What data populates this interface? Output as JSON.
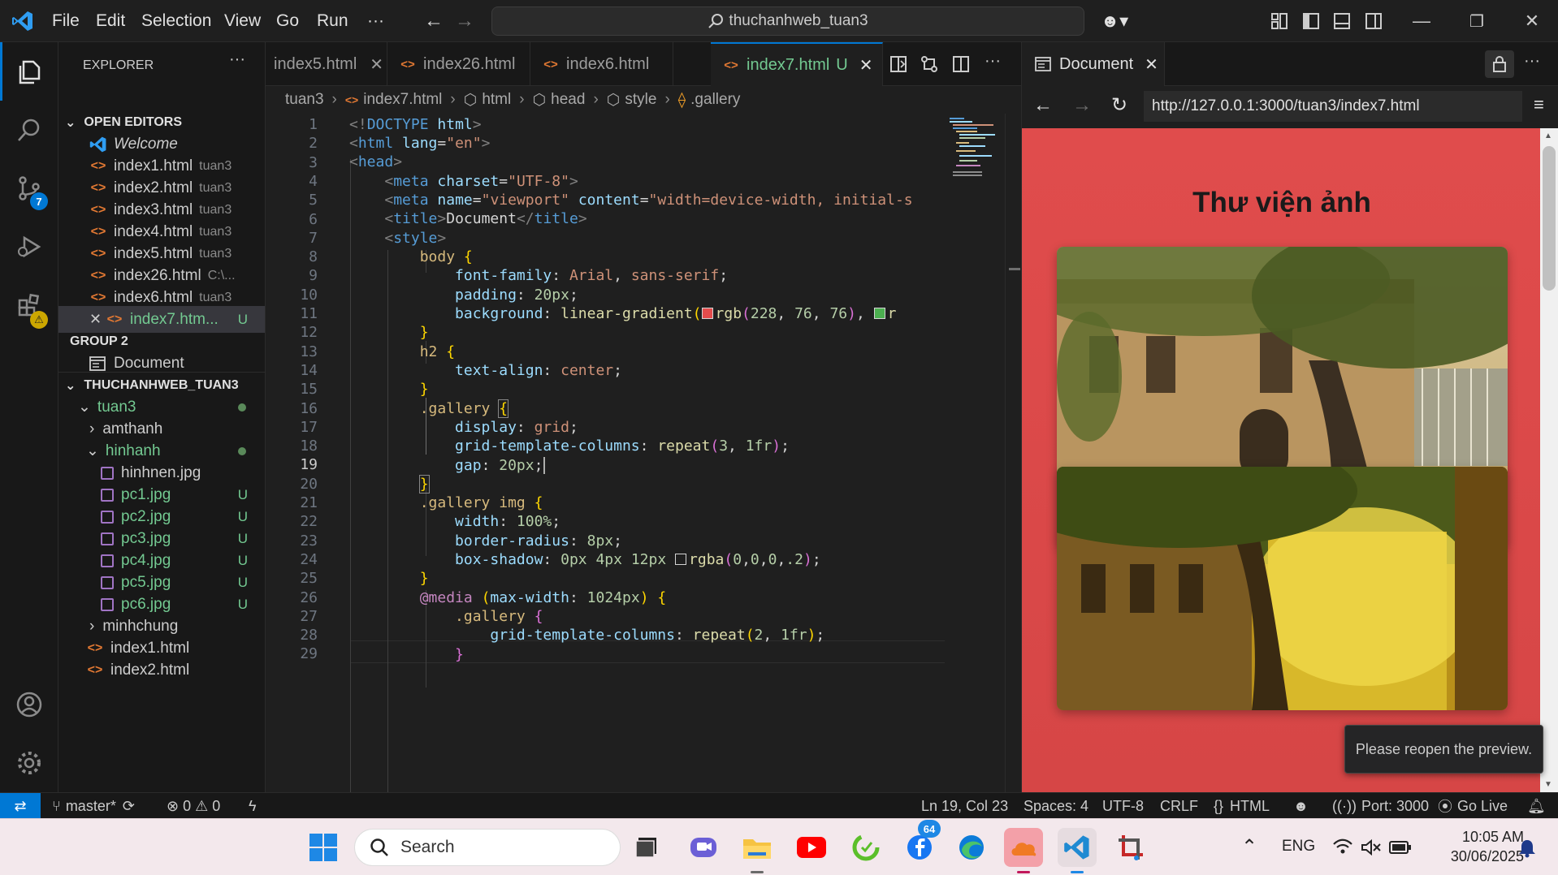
{
  "menu": [
    "File",
    "Edit",
    "Selection",
    "View",
    "Go",
    "Run",
    "···"
  ],
  "command_center": "thuchanhweb_tuan3",
  "activity_badges": {
    "source_control": "7"
  },
  "explorer": {
    "title": "EXPLORER",
    "open_editors_title": "OPEN EDITORS",
    "open_editors": [
      {
        "name": "Welcome",
        "desc": ""
      },
      {
        "name": "index1.html",
        "desc": "tuan3"
      },
      {
        "name": "index2.html",
        "desc": "tuan3"
      },
      {
        "name": "index3.html",
        "desc": "tuan3"
      },
      {
        "name": "index4.html",
        "desc": "tuan3"
      },
      {
        "name": "index5.html",
        "desc": "tuan3"
      },
      {
        "name": "index26.html",
        "desc": "C:\\..."
      },
      {
        "name": "index6.html",
        "desc": "tuan3"
      },
      {
        "name": "index7.htm...",
        "desc": "U"
      }
    ],
    "group2_title": "GROUP 2",
    "group2_item": "Document",
    "workspace_title": "THUCHANHWEB_TUAN3",
    "tree": [
      {
        "name": "tuan3",
        "kind": "folder-open"
      },
      {
        "name": "amthanh",
        "kind": "folder-closed"
      },
      {
        "name": "hinhanh",
        "kind": "folder-open"
      },
      {
        "name": "hinhnen.jpg",
        "kind": "image",
        "flag": ""
      },
      {
        "name": "pc1.jpg",
        "kind": "image",
        "flag": "U"
      },
      {
        "name": "pc2.jpg",
        "kind": "image",
        "flag": "U"
      },
      {
        "name": "pc3.jpg",
        "kind": "image",
        "flag": "U"
      },
      {
        "name": "pc4.jpg",
        "kind": "image",
        "flag": "U"
      },
      {
        "name": "pc5.jpg",
        "kind": "image",
        "flag": "U"
      },
      {
        "name": "pc6.jpg",
        "kind": "image",
        "flag": "U"
      },
      {
        "name": "minhchung",
        "kind": "folder-closed"
      },
      {
        "name": "index1.html",
        "kind": "html"
      },
      {
        "name": "index2.html",
        "kind": "html"
      }
    ]
  },
  "tabs": [
    {
      "name": "index5.html"
    },
    {
      "name": "index26.html"
    },
    {
      "name": "index6.html"
    },
    {
      "name": "index7.html",
      "flag": "U"
    }
  ],
  "breadcrumb": [
    "tuan3",
    "index7.html",
    "html",
    "head",
    "style",
    ".gallery"
  ],
  "editor": {
    "line_numbers": [
      "1",
      "2",
      "3",
      "4",
      "5",
      "6",
      "7",
      "8",
      "9",
      "10",
      "11",
      "12",
      "13",
      "14",
      "15",
      "16",
      "17",
      "18",
      "19",
      "20",
      "21",
      "22",
      "23",
      "24",
      "25",
      "26",
      "27",
      "28",
      "29"
    ],
    "current_line": "19"
  },
  "preview": {
    "tab_title": "Document",
    "url": "http://127.0.0.1:3000/tuan3/index7.html",
    "heading": "Thư viện ảnh",
    "toast": "Please reopen the preview."
  },
  "statusbar": {
    "branch": "master*",
    "errors": "0",
    "warnings": "0",
    "position": "Ln 19, Col 23",
    "spaces": "Spaces: 4",
    "encoding": "UTF-8",
    "eol": "CRLF",
    "language": "HTML",
    "port": "Port: 3000",
    "golive": "Go Live"
  },
  "taskbar": {
    "search": "Search",
    "edge_badge": "64",
    "lang": "ENG",
    "time": "10:05 AM",
    "date": "30/06/2025"
  },
  "colors": {
    "accent": "#0078d4",
    "untracked": "#73c991",
    "preview_bg": "#e04c4c"
  }
}
